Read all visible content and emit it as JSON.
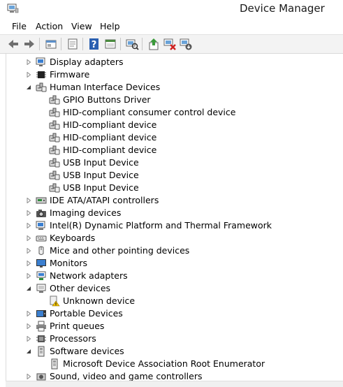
{
  "window": {
    "title": "Device Manager"
  },
  "menu": {
    "items": [
      "File",
      "Action",
      "View",
      "Help"
    ]
  },
  "toolbar": {
    "buttons": [
      "back-icon",
      "forward-icon",
      "show-hide-icon",
      "properties-icon",
      "help-icon",
      "action-view-icon",
      "scan-hardware-icon",
      "update-driver-icon",
      "uninstall-device-icon",
      "disable-device-icon"
    ]
  },
  "tree": {
    "rows": [
      {
        "label": "Display adapters",
        "level": 0,
        "expanded": false,
        "icon": "display-adapter-icon"
      },
      {
        "label": "Firmware",
        "level": 0,
        "expanded": false,
        "icon": "firmware-icon"
      },
      {
        "label": "Human Interface Devices",
        "level": 0,
        "expanded": true,
        "icon": "hid-icon"
      },
      {
        "label": "GPIO Buttons Driver",
        "level": 1,
        "icon": "hid-icon"
      },
      {
        "label": "HID-compliant consumer control device",
        "level": 1,
        "icon": "hid-icon"
      },
      {
        "label": "HID-compliant device",
        "level": 1,
        "icon": "hid-icon"
      },
      {
        "label": "HID-compliant device",
        "level": 1,
        "icon": "hid-icon"
      },
      {
        "label": "HID-compliant device",
        "level": 1,
        "icon": "hid-icon"
      },
      {
        "label": "USB Input Device",
        "level": 1,
        "icon": "hid-icon"
      },
      {
        "label": "USB Input Device",
        "level": 1,
        "icon": "hid-icon"
      },
      {
        "label": "USB Input Device",
        "level": 1,
        "icon": "hid-icon"
      },
      {
        "label": "IDE ATA/ATAPI controllers",
        "level": 0,
        "expanded": false,
        "icon": "ide-controller-icon"
      },
      {
        "label": "Imaging devices",
        "level": 0,
        "expanded": false,
        "icon": "camera-icon"
      },
      {
        "label": "Intel(R) Dynamic Platform and Thermal Framework",
        "level": 0,
        "expanded": false,
        "icon": "computer-icon"
      },
      {
        "label": "Keyboards",
        "level": 0,
        "expanded": false,
        "icon": "keyboard-icon"
      },
      {
        "label": "Mice and other pointing devices",
        "level": 0,
        "expanded": false,
        "icon": "mouse-icon"
      },
      {
        "label": "Monitors",
        "level": 0,
        "expanded": false,
        "icon": "monitor-icon"
      },
      {
        "label": "Network adapters",
        "level": 0,
        "expanded": false,
        "icon": "network-icon"
      },
      {
        "label": "Other devices",
        "level": 0,
        "expanded": true,
        "icon": "unknown-device-icon"
      },
      {
        "label": "Unknown device",
        "level": 1,
        "icon": "unknown-device-warning-icon"
      },
      {
        "label": "Portable Devices",
        "level": 0,
        "expanded": false,
        "icon": "portable-device-icon"
      },
      {
        "label": "Print queues",
        "level": 0,
        "expanded": false,
        "icon": "printer-icon"
      },
      {
        "label": "Processors",
        "level": 0,
        "expanded": false,
        "icon": "processor-icon"
      },
      {
        "label": "Software devices",
        "level": 0,
        "expanded": true,
        "icon": "software-device-icon"
      },
      {
        "label": "Microsoft Device Association Root Enumerator",
        "level": 1,
        "icon": "software-device-icon"
      },
      {
        "label": "Sound, video and game controllers",
        "level": 0,
        "expanded": false,
        "icon": "sound-icon"
      }
    ]
  },
  "colors": {
    "accent": "#1e6fc4",
    "warning": "#f2c200"
  }
}
